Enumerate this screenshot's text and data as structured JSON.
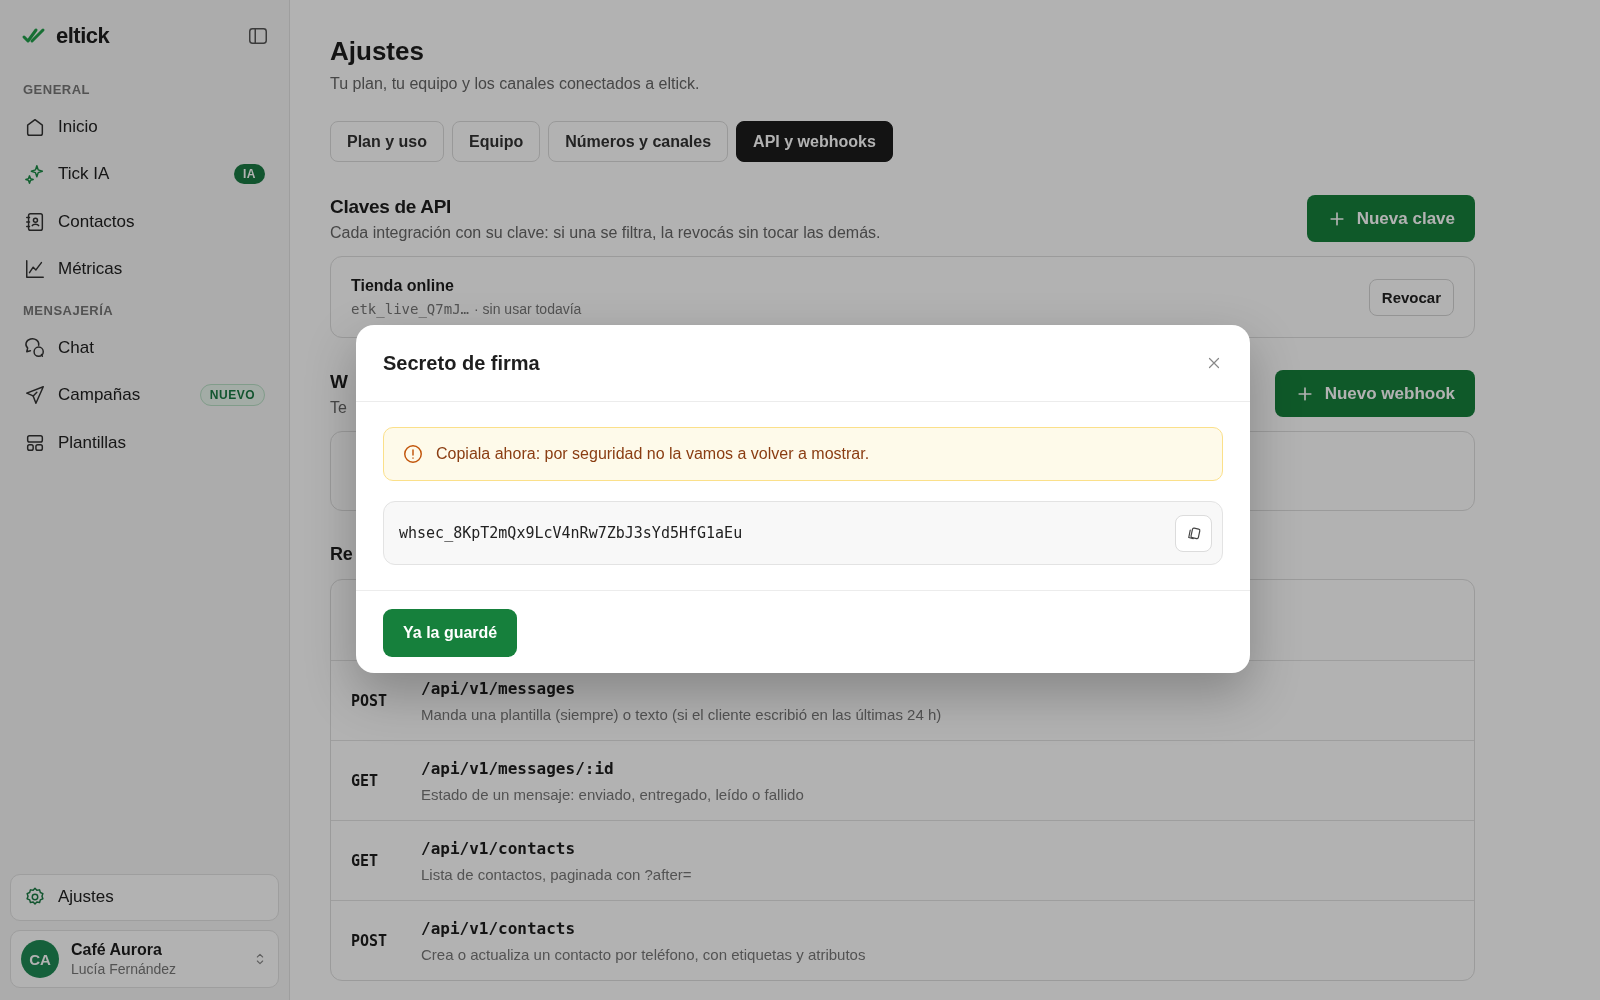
{
  "brand": {
    "name": "eltick"
  },
  "sidebar": {
    "sections": [
      {
        "title": "GENERAL",
        "items": [
          {
            "label": "Inicio",
            "selected": false
          },
          {
            "label": "Tick IA",
            "selected": false,
            "badge": {
              "text": "IA",
              "kind": "solid"
            }
          },
          {
            "label": "Contactos",
            "selected": false
          },
          {
            "label": "Métricas",
            "selected": false
          }
        ]
      },
      {
        "title": "MENSAJERÍA",
        "items": [
          {
            "label": "Chat",
            "selected": false
          },
          {
            "label": "Campañas",
            "selected": false,
            "badge": {
              "text": "NUEVO",
              "kind": "outline"
            }
          },
          {
            "label": "Plantillas",
            "selected": false
          }
        ]
      }
    ],
    "settings": {
      "label": "Ajustes",
      "selected": true
    },
    "account": {
      "initials": "CA",
      "name": "Café Aurora",
      "user": "Lucía Fernández"
    }
  },
  "page": {
    "title": "Ajustes",
    "subtitle": "Tu plan, tu equipo y los canales conectados a eltick.",
    "tabs": [
      {
        "label": "Plan y uso",
        "selected": false
      },
      {
        "label": "Equipo",
        "selected": false
      },
      {
        "label": "Números y canales",
        "selected": false
      },
      {
        "label": "API y webhooks",
        "selected": true
      }
    ],
    "api_keys": {
      "title": "Claves de API",
      "description": "Cada integración con su clave: si una se filtra, la revocás sin tocar las demás.",
      "button": "Nueva clave",
      "keys": [
        {
          "name": "Tienda online",
          "key": "etk_live_Q7mJ…",
          "usage": "· sin usar todavía",
          "action": "Revocar"
        }
      ]
    },
    "webhooks": {
      "title": "W",
      "description": "Te",
      "button": "Nuevo webhook"
    },
    "reference": {
      "title": "Re",
      "endpoints": [
        {
          "method": "POST",
          "path": "/api/v1/messages",
          "description": "Manda una plantilla (siempre) o texto (si el cliente escribió en las últimas 24 h)"
        },
        {
          "method": "GET",
          "path": "/api/v1/messages/:id",
          "description": "Estado de un mensaje: enviado, entregado, leído o fallido"
        },
        {
          "method": "GET",
          "path": "/api/v1/contacts",
          "description": "Lista de contactos, paginada con ?after="
        },
        {
          "method": "POST",
          "path": "/api/v1/contacts",
          "description": "Crea o actualiza un contacto por teléfono, con etiquetas y atributos"
        }
      ]
    }
  },
  "modal": {
    "title": "Secreto de firma",
    "alert": "Copiala ahora: por seguridad no la vamos a volver a mostrar.",
    "secret": "whsec_8KpT2mQx9LcV4nRw7ZbJ3sYd5HfG1aEu",
    "button": "Ya la guardé"
  }
}
